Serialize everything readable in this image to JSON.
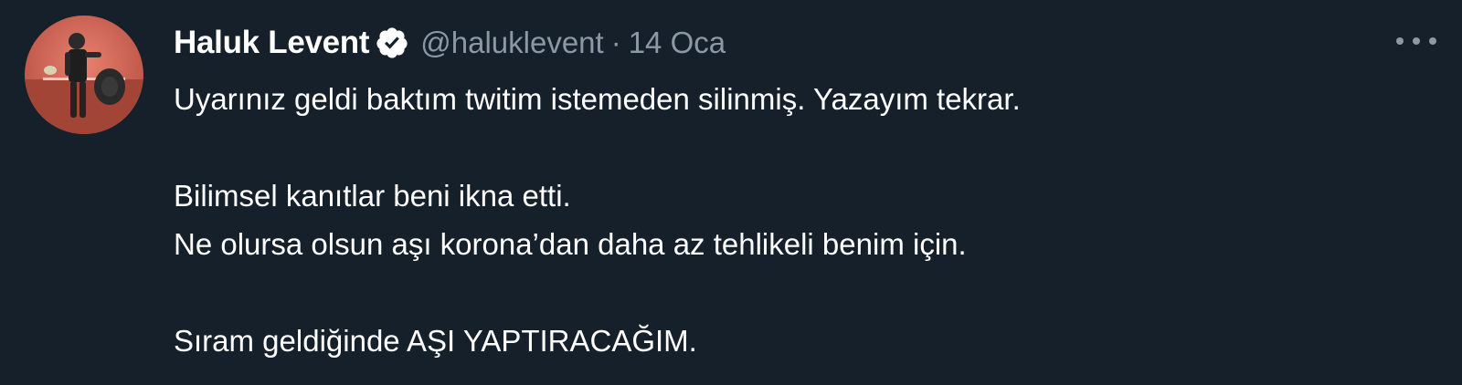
{
  "tweet": {
    "author": {
      "display_name": "Haluk Levent",
      "handle": "@haluklevent",
      "verified": true
    },
    "separator": "·",
    "timestamp": "14 Oca",
    "lines": [
      "Uyarınız geldi baktım twitim istemeden silinmiş. Yazayım tekrar.",
      "",
      "Bilimsel kanıtlar beni ikna etti.",
      "Ne olursa olsun aşı korona’dan daha az tehlikeli benim için.",
      "",
      "Sıram geldiğinde AŞI YAPTIRACAĞIM."
    ]
  },
  "colors": {
    "background": "#15202b",
    "text_primary": "#ffffff",
    "text_secondary": "#8b98a5",
    "verified_badge": "#ffffff"
  },
  "icons": {
    "verified": "verified-badge-icon",
    "more": "more-options-icon"
  }
}
